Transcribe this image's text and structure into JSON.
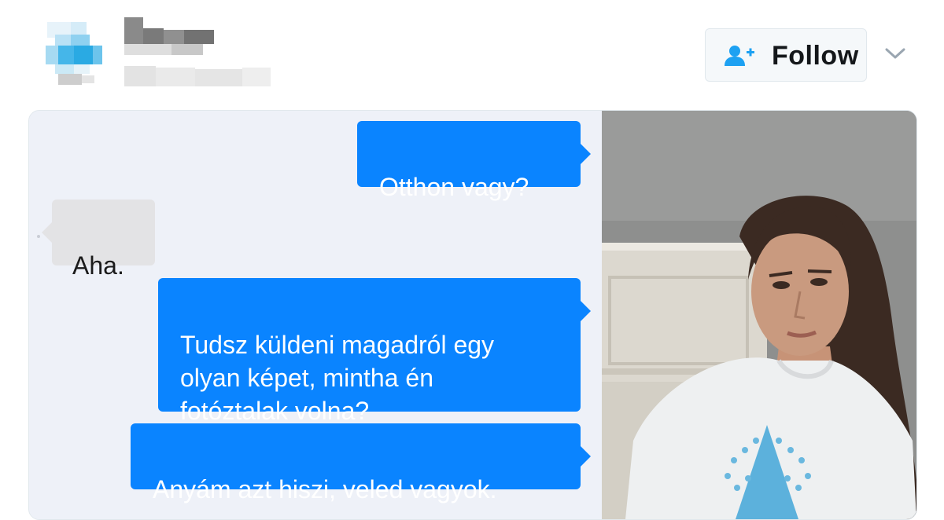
{
  "header": {
    "follow_button": {
      "label": "Follow",
      "icon": "add-user-icon"
    },
    "more_menu": {
      "icon": "chevron-down-icon"
    }
  },
  "chat": {
    "messages": [
      {
        "side": "outgoing",
        "text": "Otthon vagy?"
      },
      {
        "side": "incoming",
        "text": "Aha."
      },
      {
        "side": "outgoing",
        "text": "Tudsz küldeni magadról egy\nolyan képet, mintha én\nfotóztalak volna?"
      },
      {
        "side": "outgoing",
        "text": "Anyám azt hiszi, veled vagyok."
      }
    ]
  },
  "photo": {
    "icon": "photo-image"
  },
  "colors": {
    "outgoing_bubble": "#0a84ff",
    "incoming_bubble": "#e3e3e5",
    "chat_background": "#eef1f8",
    "follow_icon": "#1da1f2"
  }
}
